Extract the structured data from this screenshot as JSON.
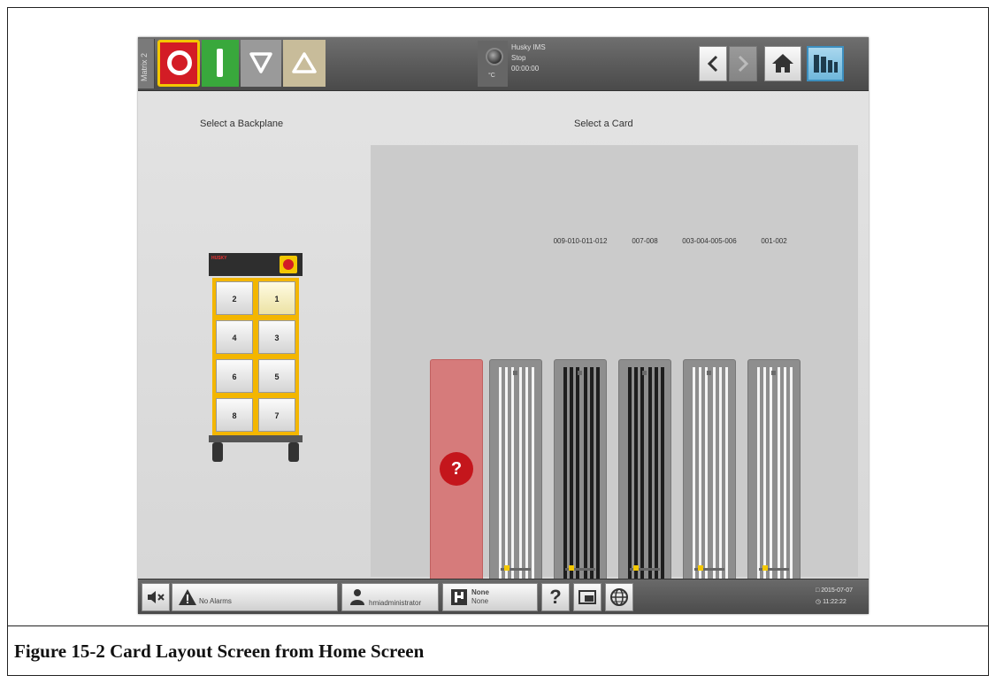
{
  "caption": "Figure 15-2 Card Layout Screen from Home Screen",
  "topbar": {
    "side_tab": "Matrix 2",
    "status": {
      "unit": "°C",
      "app_name": "Husky IMS",
      "state": "Stop",
      "timer": "00:00:00"
    },
    "icons": [
      "stop-icon",
      "start-icon",
      "ramp-down-icon",
      "ramp-up-icon",
      "back-icon",
      "forward-icon",
      "home-icon",
      "layout-icon"
    ]
  },
  "left_panel": {
    "title": "Select a Backplane",
    "brand": "HUSKY",
    "slots": [
      "2",
      "1",
      "4",
      "3",
      "6",
      "5",
      "8",
      "7"
    ],
    "selected_slot": "1"
  },
  "right_panel": {
    "title": "Select a Card",
    "unknown_card_symbol": "?",
    "cards": [
      {
        "label": "",
        "variant": "light"
      },
      {
        "label": "009-010-011-012",
        "variant": "dark"
      },
      {
        "label": "007-008",
        "variant": "dark"
      },
      {
        "label": "003-004-005-006",
        "variant": "light"
      },
      {
        "label": "001-002",
        "variant": "light"
      }
    ]
  },
  "bottombar": {
    "alarms": "No Alarms",
    "user": "hmiadministrator",
    "mold_title": "None",
    "mold_sub": "None",
    "help_symbol": "?",
    "date": "2015-07-07",
    "time": "11:22:22"
  },
  "colors": {
    "stop_red": "#d31c25",
    "start_green": "#39a83c",
    "highlight_yellow": "#f3c700",
    "unknown_card": "#d67b7b",
    "layout_blue": "#6fb7db"
  }
}
